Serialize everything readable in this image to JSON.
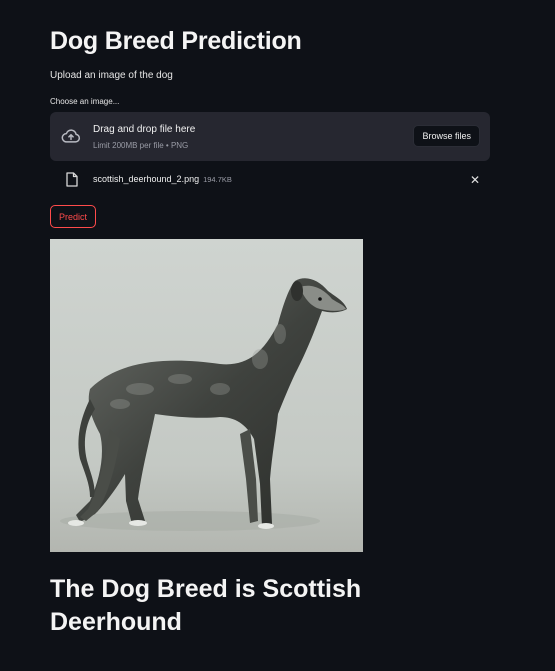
{
  "header": {
    "title": "Dog Breed Prediction",
    "subtitle": "Upload an image of the dog"
  },
  "uploader": {
    "label": "Choose an image...",
    "drag_text": "Drag and drop file here",
    "limit_text": "Limit 200MB per file • PNG",
    "browse_label": "Browse files",
    "upload_icon": "cloud-upload-icon"
  },
  "uploaded_file": {
    "name": "scottish_deerhound_2.png",
    "size": "194.7KB",
    "file_icon": "file-icon",
    "remove_icon": "close-icon",
    "remove_glyph": "✕"
  },
  "actions": {
    "predict_label": "Predict"
  },
  "result": {
    "text": "The Dog Breed is Scottish Deerhound"
  },
  "colors": {
    "background": "#0e1117",
    "panel": "#262730",
    "accent": "#ff4b4b",
    "text": "#fafafa"
  }
}
